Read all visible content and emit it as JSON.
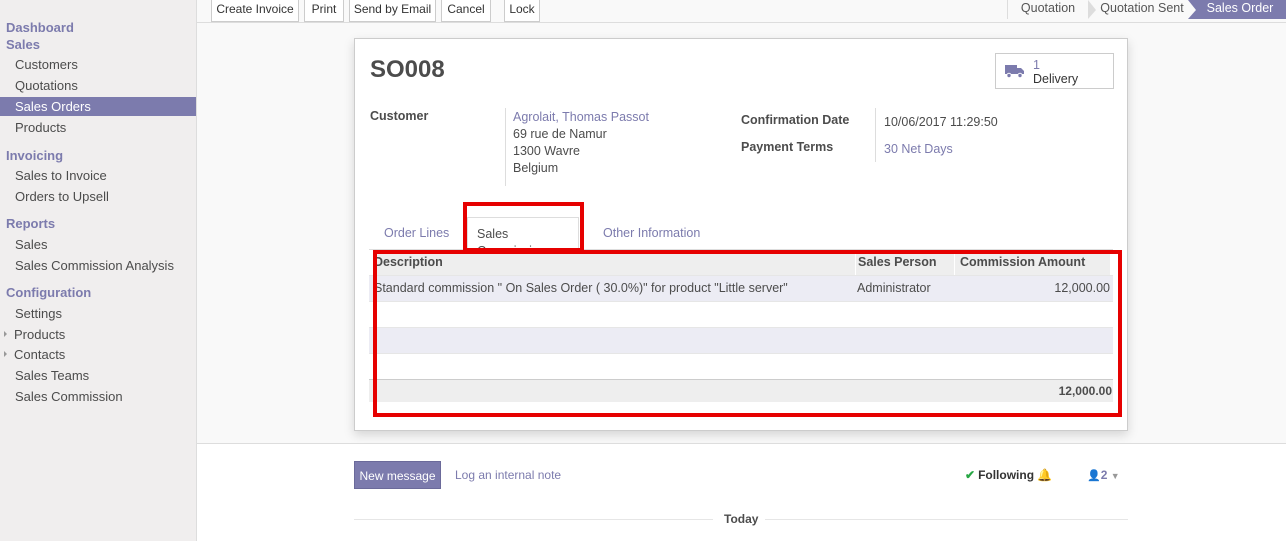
{
  "sidebar": {
    "dashboard": "Dashboard",
    "sales_header": "Sales",
    "sales_items": [
      "Customers",
      "Quotations",
      "Sales Orders",
      "Products"
    ],
    "invoicing_header": "Invoicing",
    "invoicing_items": [
      "Sales to Invoice",
      "Orders to Upsell"
    ],
    "reports_header": "Reports",
    "reports_items": [
      "Sales",
      "Sales Commission Analysis"
    ],
    "configuration_header": "Configuration",
    "configuration_items": [
      "Settings",
      "Products",
      "Contacts",
      "Sales Teams",
      "Sales Commission"
    ]
  },
  "toolbar": {
    "buttons": [
      "Create Invoice",
      "Print",
      "Send by Email",
      "Cancel",
      "Lock"
    ]
  },
  "statusbar": {
    "steps": [
      "Quotation",
      "Quotation Sent",
      "Sales Order"
    ],
    "active": "Sales Order"
  },
  "order": {
    "name": "SO008",
    "delivery_count": "1",
    "delivery_label": "Delivery",
    "customer_label": "Customer",
    "customer_name": "Agrolait, Thomas Passot",
    "address_line1": "69 rue de Namur",
    "address_line2": "1300 Wavre",
    "address_line3": "Belgium",
    "confirmation_label": "Confirmation Date",
    "confirmation_value": "10/06/2017 11:29:50",
    "payment_label": "Payment Terms",
    "payment_value": "30 Net Days"
  },
  "tabs": [
    "Order Lines",
    "Sales Commission",
    "Other Information"
  ],
  "active_tab": "Sales Commission",
  "commission_table": {
    "headers": [
      "Description",
      "Sales Person",
      "Commission Amount"
    ],
    "rows": [
      {
        "description": "Standard commission \" On Sales Order ( 30.0%)\" for product \"Little server\"",
        "sales_person": "Administrator",
        "amount": "12,000.00"
      }
    ],
    "total": "12,000.00"
  },
  "chatter": {
    "new_message": "New message",
    "log_note": "Log an internal note",
    "following": "Following",
    "followers_count": "2",
    "today": "Today"
  },
  "colors": {
    "accent": "#7c7bad",
    "highlight": "#e60000"
  }
}
